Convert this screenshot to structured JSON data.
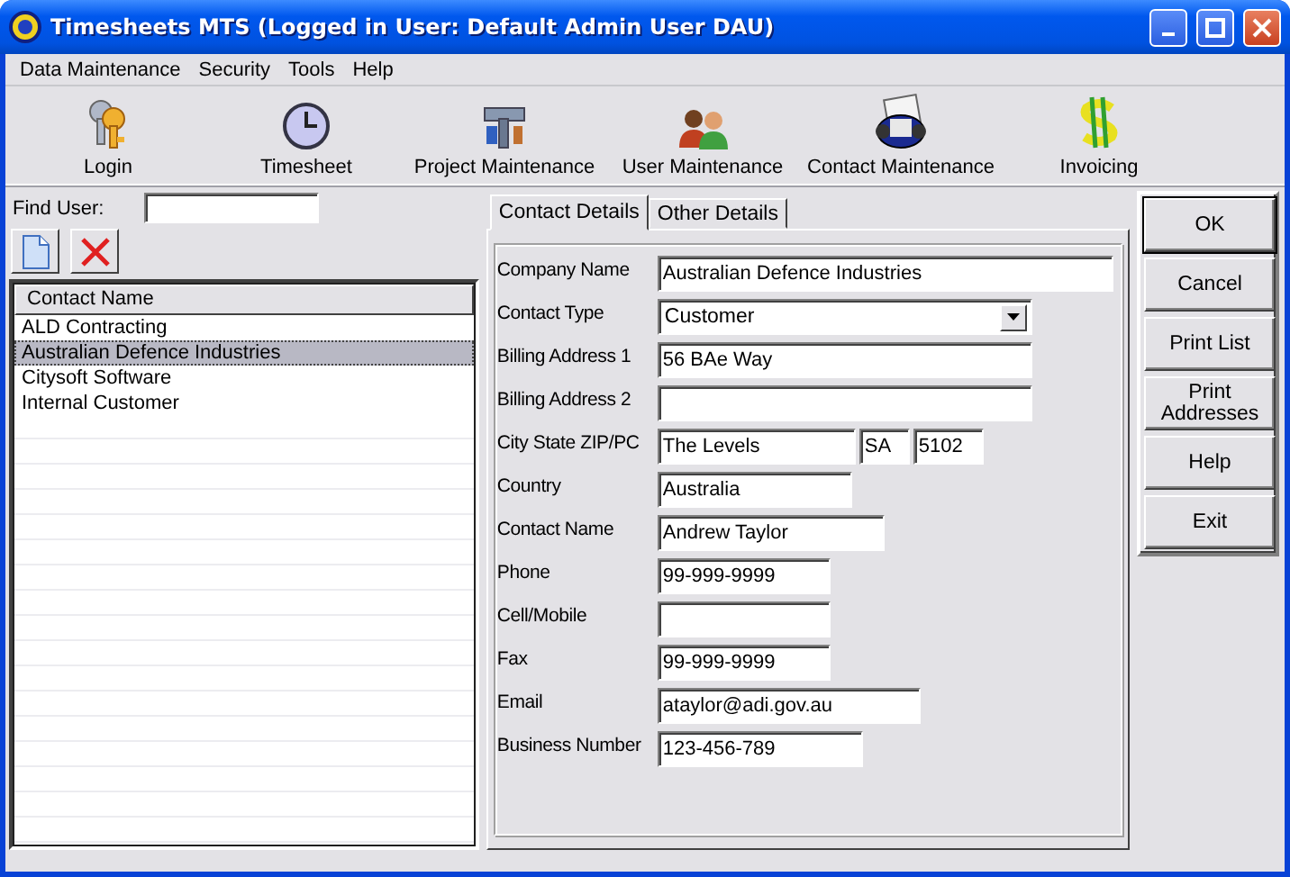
{
  "window": {
    "title": "Timesheets MTS (Logged in User: Default Admin User DAU)"
  },
  "menu": [
    "Data Maintenance",
    "Security",
    "Tools",
    "Help"
  ],
  "toolbar": [
    {
      "label": "Login",
      "kind": "keys"
    },
    {
      "label": "Timesheet",
      "kind": "clock"
    },
    {
      "label": "Project Maintenance",
      "kind": "tools"
    },
    {
      "label": "User Maintenance",
      "kind": "users"
    },
    {
      "label": "Contact Maintenance",
      "kind": "rolodex"
    },
    {
      "label": "Invoicing",
      "kind": "dollar"
    }
  ],
  "find_user": {
    "label": "Find User:"
  },
  "list": {
    "column": "Contact Name",
    "rows": [
      {
        "name": "ALD Contracting",
        "selected": false
      },
      {
        "name": "Australian Defence Industries",
        "selected": true
      },
      {
        "name": "Citysoft Software",
        "selected": false
      },
      {
        "name": "Internal Customer",
        "selected": false
      }
    ]
  },
  "tabs": [
    {
      "label": "Contact Details",
      "selected": true
    },
    {
      "label": "Other Details",
      "selected": false
    }
  ],
  "form": [
    {
      "label": "Company Name",
      "kind": "text",
      "value": "Australian Defence Industries"
    },
    {
      "label": "Contact Type",
      "kind": "select",
      "value": "Customer"
    },
    {
      "label": "Billing Address 1",
      "kind": "text",
      "value": "56 BAe Way"
    },
    {
      "label": "Billing Address 2",
      "kind": "text"
    },
    {
      "label": "City State ZIP/PC",
      "kind": "multi",
      "values": [
        "The Levels",
        "SA",
        "5102"
      ]
    },
    {
      "label": "Country",
      "kind": "text",
      "value": "Australia"
    },
    {
      "label": "Contact Name",
      "kind": "text",
      "value": "Andrew Taylor"
    },
    {
      "label": "Phone",
      "kind": "text",
      "value": "99-999-9999"
    },
    {
      "label": "Cell/Mobile",
      "kind": "text"
    },
    {
      "label": "Fax",
      "kind": "text",
      "value": "99-999-9999"
    },
    {
      "label": "Email",
      "kind": "text",
      "value": "ataylor@adi.gov.au"
    },
    {
      "label": "Business Number",
      "kind": "text",
      "value": "123-456-789"
    }
  ],
  "buttons": [
    "OK",
    "Cancel",
    "Print List",
    "Print Addresses",
    "Help",
    "Exit"
  ]
}
